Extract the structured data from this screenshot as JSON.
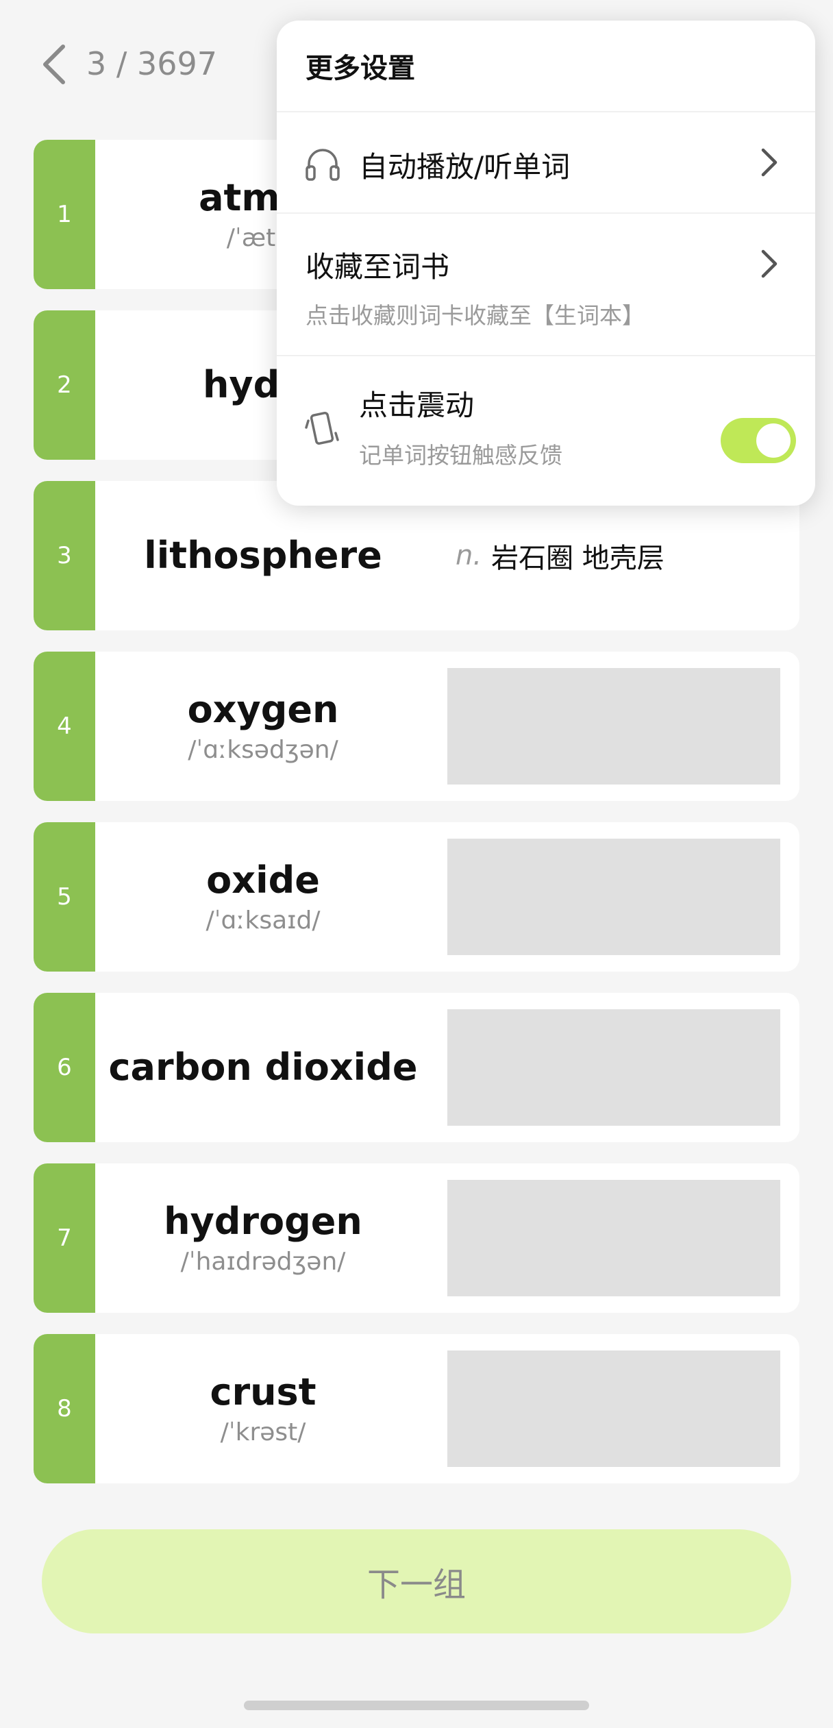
{
  "header": {
    "progress": "3 / 3697"
  },
  "words": [
    {
      "num": "1",
      "word": "atmos",
      "phonetic": "/ˈætm",
      "meaning_hidden": false
    },
    {
      "num": "2",
      "word": "hydro",
      "phonetic": "",
      "meaning_hidden": false
    },
    {
      "num": "3",
      "word": "lithosphere",
      "phonetic": "",
      "pos": "n.",
      "meaning": "岩石圈  地壳层"
    },
    {
      "num": "4",
      "word": "oxygen",
      "phonetic": "/ˈɑːksədʒən/",
      "meaning_hidden": true
    },
    {
      "num": "5",
      "word": "oxide",
      "phonetic": "/ˈɑːksaɪd/",
      "meaning_hidden": true
    },
    {
      "num": "6",
      "word": "carbon dioxide",
      "phonetic": "",
      "meaning_hidden": true
    },
    {
      "num": "7",
      "word": "hydrogen",
      "phonetic": "/ˈhaɪdrədʒən/",
      "meaning_hidden": true
    },
    {
      "num": "8",
      "word": "crust",
      "phonetic": "/ˈkrəst/",
      "meaning_hidden": true
    }
  ],
  "next_button": {
    "label": "下一组"
  },
  "popup": {
    "title": "更多设置",
    "auto_play": {
      "label": "自动播放/听单词",
      "icon": "headphones-icon"
    },
    "favorite": {
      "label": "收藏至词书",
      "sub": "点击收藏则词卡收藏至【生词本】"
    },
    "vibration": {
      "label": "点击震动",
      "sub": "记单词按钮触感反馈",
      "icon": "phone-vibrate-icon",
      "enabled": true
    }
  },
  "colors": {
    "accent_green": "#8cc152",
    "toggle_on": "#bfe857",
    "button_bg": "#e2f5b4"
  }
}
